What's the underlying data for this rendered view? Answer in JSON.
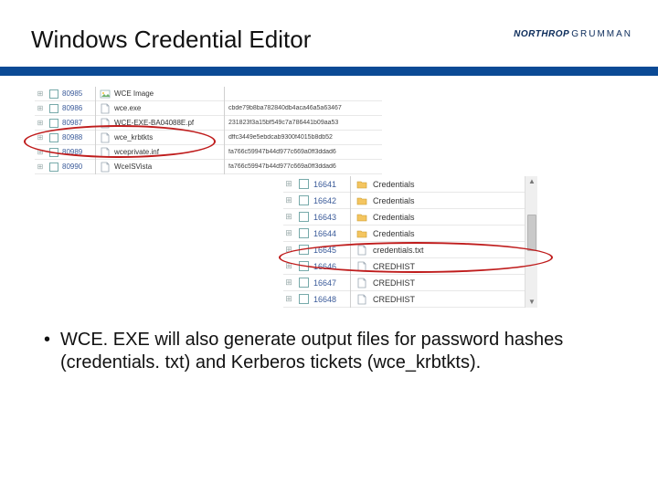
{
  "title": "Windows Credential Editor",
  "brand": {
    "part1": "NORTHROP",
    "part2": "GRUMMAN"
  },
  "panel1": {
    "rows": [
      {
        "id": "80985",
        "icon": "image",
        "name": "WCE Image",
        "hash": ""
      },
      {
        "id": "80986",
        "icon": "file",
        "name": "wce.exe",
        "hash": "cbde79b8ba782840db4aca46a5a63467"
      },
      {
        "id": "80987",
        "icon": "file",
        "name": "WCE-EXE-BA04088E.pf",
        "hash": "231823f3a15bf549c7a786441b09aa53"
      },
      {
        "id": "80988",
        "icon": "file",
        "name": "wce_krbtkts",
        "hash": "dffc3449e5ebdcab9300f4015b8db52"
      },
      {
        "id": "80989",
        "icon": "file",
        "name": "wceprivate.inf",
        "hash": "fa766c59947b44d977c669a0ff3ddad6"
      },
      {
        "id": "80990",
        "icon": "file",
        "name": "WceISVista",
        "hash": "fa766c59947b44d977c669a0ff3ddad6"
      }
    ]
  },
  "panel2": {
    "rows": [
      {
        "id": "16641",
        "icon": "folder",
        "name": "Credentials"
      },
      {
        "id": "16642",
        "icon": "folder",
        "name": "Credentials"
      },
      {
        "id": "16643",
        "icon": "folder",
        "name": "Credentials"
      },
      {
        "id": "16644",
        "icon": "folder",
        "name": "Credentials"
      },
      {
        "id": "16645",
        "icon": "file",
        "name": "credentials.txt"
      },
      {
        "id": "16646",
        "icon": "file",
        "name": "CREDHIST"
      },
      {
        "id": "16647",
        "icon": "file",
        "name": "CREDHIST"
      },
      {
        "id": "16648",
        "icon": "file",
        "name": "CREDHIST"
      }
    ]
  },
  "bullet": {
    "dot": "•",
    "text": "WCE. EXE will also generate output files for password hashes (credentials. txt) and Kerberos tickets (wce_krbtkts)."
  }
}
